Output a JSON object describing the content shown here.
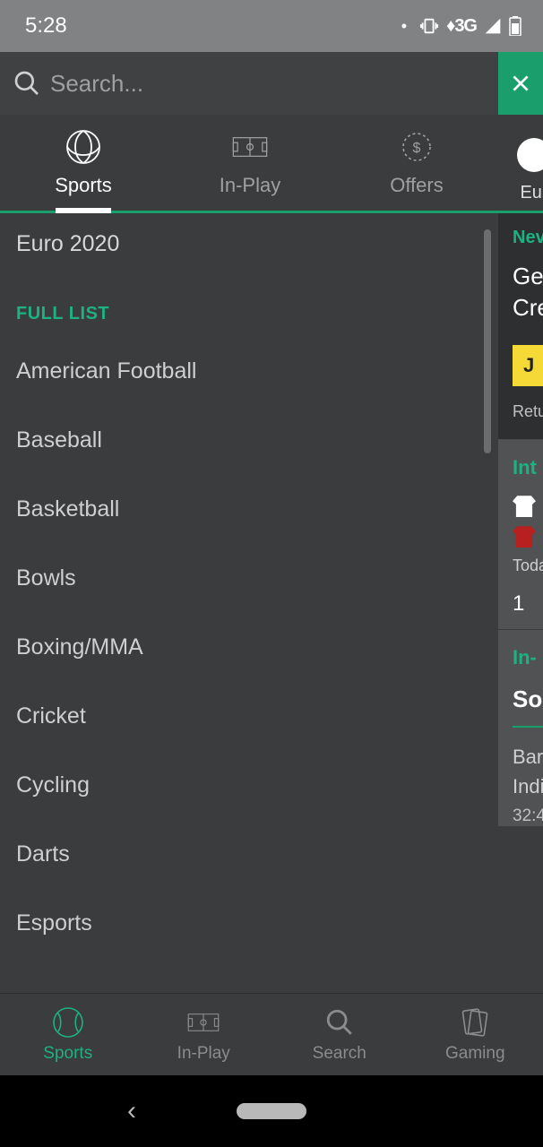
{
  "status": {
    "time": "5:28",
    "net": "3G"
  },
  "search": {
    "placeholder": "Search..."
  },
  "tabs": {
    "sports": "Sports",
    "inplay": "In-Play",
    "offers": "Offers",
    "extra": "Eur"
  },
  "featured": {
    "item0": "Euro 2020"
  },
  "section": {
    "full_list": "FULL LIST"
  },
  "sports_list": [
    "American Football",
    "Baseball",
    "Basketball",
    "Bowls",
    "Boxing/MMA",
    "Cricket",
    "Cycling",
    "Darts",
    "Esports"
  ],
  "peek": {
    "promo_new": "Nev",
    "promo_line1": "Ge",
    "promo_line2": "Cre",
    "promo_btn": "J",
    "promo_ret": "Retu",
    "int_title": "Int",
    "int_time": "Toda",
    "int_num": "1",
    "inplay_title": "In-",
    "inplay_sport": "So",
    "inplay_t1": "Bar",
    "inplay_t2": "Indi",
    "inplay_clock": "32:4"
  },
  "bottom_nav": {
    "sports": "Sports",
    "inplay": "In-Play",
    "search": "Search",
    "gaming": "Gaming"
  }
}
